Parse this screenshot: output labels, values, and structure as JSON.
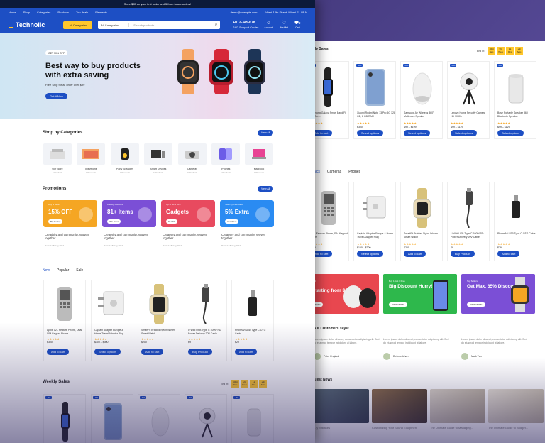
{
  "topbar": {
    "text": "Save $55 on your first order and 5% on future orders!"
  },
  "nav": {
    "items": [
      "Home",
      "Shop",
      "Categories",
      "Products",
      "Top deals",
      "Elements"
    ],
    "email": "demo@example.com",
    "address": "West 12th Street, Miami FL USA"
  },
  "header": {
    "logo": "Technolic",
    "all_categories": "All Categories",
    "search_category": "All Categories",
    "search_placeholder": "Search products...",
    "phone": "+012-345-678",
    "phone_sub": "24/7 Support Center",
    "account": "Account",
    "wishlist": "Wishlist",
    "cart": "Cart"
  },
  "hero": {
    "badge": "GET 50% OFF",
    "title": "Best way to buy products with extra saving",
    "subtitle": "Free Ship for all order over $99",
    "button": "Get It Now"
  },
  "categories": {
    "title": "Shop by Categories",
    "view_all": "View All",
    "items": [
      {
        "name": "Our Store",
        "count": "4 Products"
      },
      {
        "name": "Televisions",
        "count": "3 Products"
      },
      {
        "name": "Party Speakers",
        "count": "3 Products"
      },
      {
        "name": "Smart Devices",
        "count": "4 Products"
      },
      {
        "name": "Cameras",
        "count": "3 Products"
      },
      {
        "name": "iPhones",
        "count": "4 Products"
      },
      {
        "name": "MacBook",
        "count": "3 Products"
      }
    ]
  },
  "promotions": {
    "title": "Promotions",
    "view_all": "View All",
    "items": [
      {
        "kicker": "Buy & Save",
        "headline": "15% OFF",
        "button": "Big Saving",
        "caption": "Creativity and community. Woven together.",
        "date": "Posted 18 Aug 2024",
        "color": "#f5a623"
      },
      {
        "kicker": "Weekly Discount",
        "headline": "81+ Items",
        "button": "Win Items",
        "caption": "Creativity and community. Woven together.",
        "date": "Posted 18 Aug 2024",
        "color": "#7b4fd6"
      },
      {
        "kicker": "Up to 60% OFF",
        "headline": "Gadgets",
        "button": "60 OFF",
        "caption": "Creativity and community. Woven together.",
        "date": "Posted 18 Aug 2024",
        "color": "#e84a5f"
      },
      {
        "kicker": "Save by Cashback",
        "headline": "5% Extra",
        "button": "Cashback",
        "caption": "Creativity and community. Woven together.",
        "date": "Posted 18 Aug 2024",
        "color": "#2a8bf2"
      }
    ]
  },
  "tabs": [
    "New",
    "Popular",
    "Sale"
  ],
  "products": [
    {
      "name": "Apple 12 - Feature Phone, Dual SIM Keypad Phone",
      "price": "$300",
      "button": "Add to cart"
    },
    {
      "name": "Captain Adapter Europe & Home Travel Adapter Plug",
      "price": "$100 – $300",
      "button": "Select options"
    },
    {
      "name": "SmartFit Braided Nylon Woven Smart Watch",
      "price": "$200",
      "button": "Add to cart"
    },
    {
      "name": "U Wild USB Type C 100W PD Power Delivery 20V Cable",
      "price": "$9",
      "button": "Buy Product"
    },
    {
      "name": "PhoneArt USB Type C OTG Cable",
      "price": "$29",
      "button": "Add to cart"
    }
  ],
  "weekly": {
    "title": "Weekly Sales",
    "ends_in": "End In:",
    "timer": [
      {
        "v": "353",
        "l": "Days"
      },
      {
        "v": "03",
        "l": "Hours"
      },
      {
        "v": "11",
        "l": "Mins"
      },
      {
        "v": "26",
        "l": "Secs"
      }
    ],
    "tags": [
      "-9%",
      "-9%",
      "-6%",
      "-9%",
      "-9%"
    ]
  },
  "back": {
    "sales_title": "ly Sales",
    "ends_in": "End In:",
    "timer": [
      {
        "v": "353",
        "l": "Days"
      },
      {
        "v": "03",
        "l": "Hours"
      },
      {
        "v": "11",
        "l": "Mins"
      },
      {
        "v": "26",
        "l": "Secs"
      }
    ],
    "sale_products": [
      {
        "tag": "-9%",
        "name": "Samsung Galaxy Smart Band Fit 8th Gen...",
        "price": "$20",
        "button": "Add to cart"
      },
      {
        "tag": "-9%",
        "name": "Xiaomi Redmi Note 13 Pro 5G 128 GB, 8 GB RAM",
        "price": "$300",
        "button": "Select options"
      },
      {
        "tag": "-6%",
        "name": "Samsung Air Wireless 360° Multiroom Speaker",
        "price": "$99 – $199",
        "button": "Select options"
      },
      {
        "tag": "-9%",
        "name": "Lenovo Home Security Camera HD 1080p",
        "price": "$99 – $129",
        "button": "Select options"
      },
      {
        "tag": "-9%",
        "name": "Bose Portable Speaker 360 Bluetooth Speaker",
        "price": "$99 – $129",
        "button": "Select options"
      }
    ],
    "tabs": [
      "nics",
      "Cameras",
      "Phones"
    ],
    "tab_products": [
      {
        "name": "l 12 - Feature Phone, SIM Keypad Phone",
        "price": "$300",
        "button": "Add to cart"
      },
      {
        "name": "Captain Adapter Europe & Home Travel Adapter Plug",
        "price": "$100 – $300",
        "button": "Select options"
      },
      {
        "name": "SmartFit Braided Nylon Woven Smart Watch",
        "price": "$200",
        "button": "Add to cart"
      },
      {
        "name": "U Wild USB Type C 100W PD Power Delivery 20V Cable",
        "price": "$9",
        "button": "Buy Product"
      },
      {
        "name": "PhoneArt USB Type C OTG Cable",
        "price": "$29",
        "button": "Add to cart"
      }
    ],
    "banners": [
      {
        "kicker": "",
        "headline": "Starting from $119.00",
        "prefix": "rted",
        "button": "NOW"
      },
      {
        "kicker": "Buy 1 Get 1 Free",
        "headline": "Big Discount Hurry!",
        "button": "VIEW MORE"
      },
      {
        "kicker": "Top Sellers",
        "headline": "Get Max. 65% Discount",
        "button": "VIEW MORE"
      }
    ],
    "testimonials_title": "our Customers says!",
    "testimonials": [
      {
        "text": "Lorem ipsum dolor sit amet, consectetur adipiscing elit. Sed do eiusmod tempor incididunt ut labore.",
        "name": "Peter England"
      },
      {
        "text": "Lorem ipsum dolor sit amet, consectetur adipiscing elit. Sed do eiusmod tempor incididunt ut labore.",
        "name": "Definne Uhan"
      },
      {
        "text": "Lorem ipsum dolor sit amet, consectetur adipiscing elit. Sed do eiusmod tempor incididunt ut labore.",
        "name": "Mark Yan"
      }
    ],
    "news_title": "atest News",
    "news": [
      {
        "title": "...ly Mistakes"
      },
      {
        "title": "Customizing Your Sound Equipment"
      },
      {
        "title": "The Ultimate Guide to Managing..."
      },
      {
        "title": "The Ultimate Guide to Budget..."
      }
    ]
  },
  "colors": {
    "primary": "#1d4fc4",
    "accent": "#ffc72c",
    "dark": "#0c1a3a"
  }
}
